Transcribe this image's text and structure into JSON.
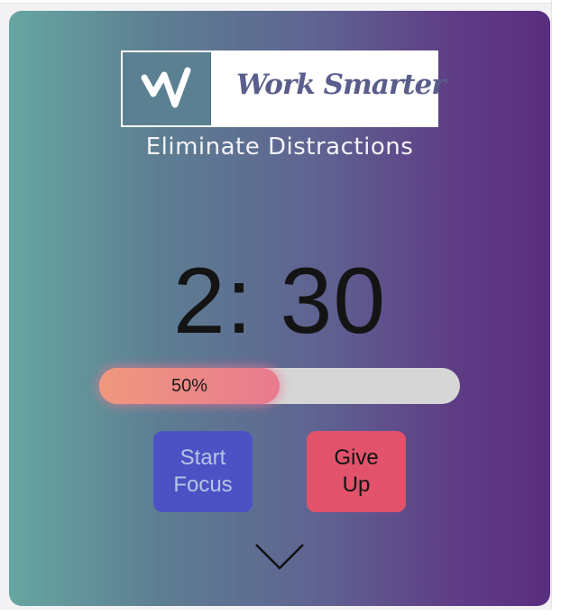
{
  "brand": {
    "logo_name": "Work Smarter",
    "tagline": "Eliminate Distractions",
    "logo_mark_color": "#5b8092",
    "logo_text_color": "#5a5e8c"
  },
  "timer": {
    "display": "2: 30"
  },
  "progress": {
    "percent": 50,
    "label": "50%"
  },
  "buttons": {
    "start_label": "Start\nFocus",
    "giveup_label": "Give\nUp",
    "start_color": "#4c52c4",
    "giveup_color": "#e2536b"
  },
  "icons": {
    "logo": "w-logo-icon",
    "expand": "chevron-down-icon"
  },
  "theme": {
    "gradient_start": "#66a6a1",
    "gradient_end": "#5a2d7e",
    "progress_start": "#f0987e",
    "progress_end": "#e87a8f"
  }
}
